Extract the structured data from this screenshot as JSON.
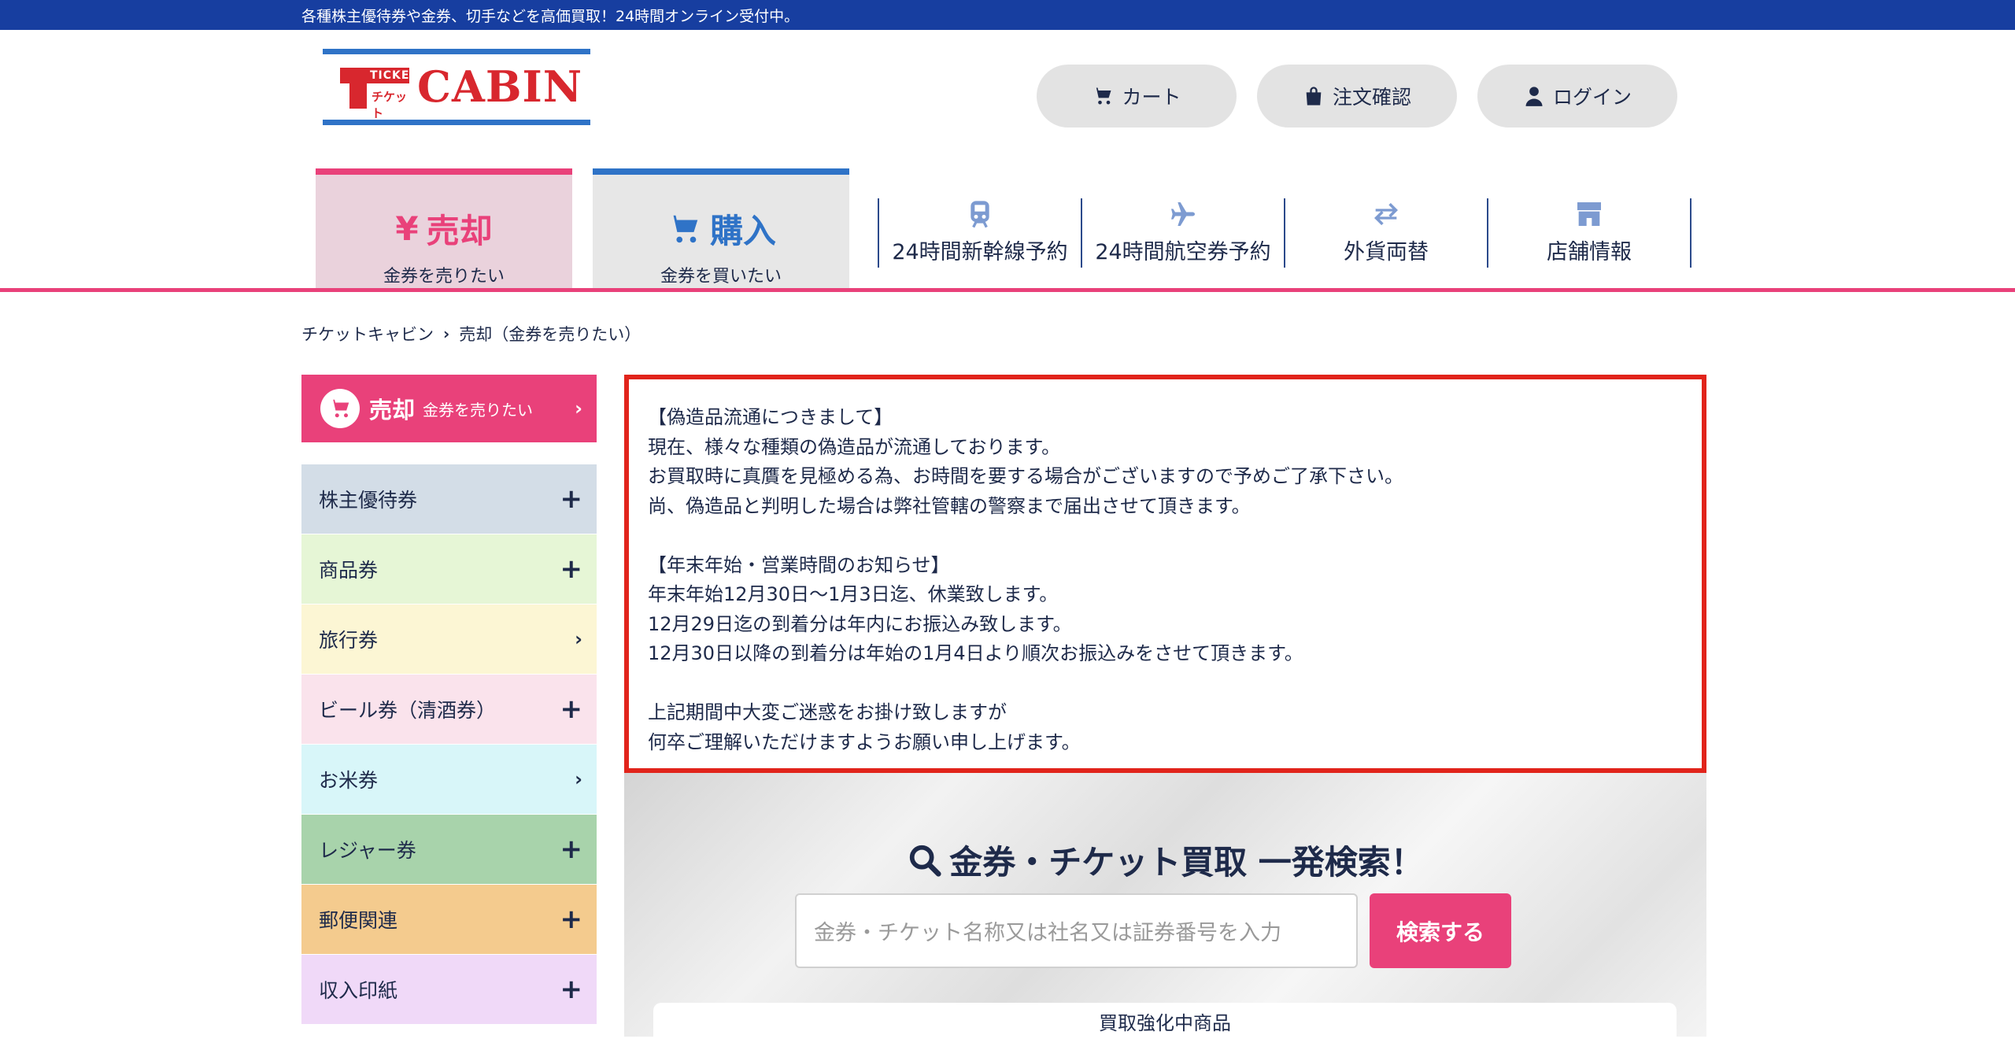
{
  "topbar": {
    "text": "各種株主優待券や金券、切手などを高価買取！24時間オンライン受付中。"
  },
  "logo": {
    "small_top": "TICKET",
    "small_bottom": "チケット",
    "brand": "CABIN"
  },
  "header_buttons": {
    "cart": "カート",
    "order": "注文確認",
    "login": "ログイン"
  },
  "tabs": {
    "sell": {
      "label": "売却",
      "sub": "金券を売りたい",
      "icon": "yen-icon"
    },
    "buy": {
      "label": "購入",
      "sub": "金券を買いたい",
      "icon": "cart-icon"
    }
  },
  "nav": [
    {
      "label": "24時間新幹線予約",
      "icon": "train-icon"
    },
    {
      "label": "24時間航空券予約",
      "icon": "plane-icon"
    },
    {
      "label": "外貨両替",
      "icon": "exchange-icon"
    },
    {
      "label": "店舗情報",
      "icon": "store-icon"
    }
  ],
  "breadcrumb": {
    "home": "チケットキャビン",
    "current": "売却（金券を売りたい）"
  },
  "sidebar": {
    "head_title": "売却",
    "head_sub": "金券を売りたい",
    "items": [
      {
        "label": "株主優待券",
        "mark": "+",
        "color": "#d3dde7"
      },
      {
        "label": "商品券",
        "mark": "+",
        "color": "#e6f6d6"
      },
      {
        "label": "旅行券",
        "mark": "›",
        "color": "#fcf6d4"
      },
      {
        "label": "ビール券（清酒券）",
        "mark": "+",
        "color": "#fae3ec"
      },
      {
        "label": "お米券",
        "mark": "›",
        "color": "#d8f6f9"
      },
      {
        "label": "レジャー券",
        "mark": "+",
        "color": "#a8d3ab"
      },
      {
        "label": "郵便関連",
        "mark": "+",
        "color": "#f4cb8e"
      },
      {
        "label": "収入印紙",
        "mark": "+",
        "color": "#f0d9f8"
      }
    ]
  },
  "notice": {
    "lines": [
      "【偽造品流通につきまして】",
      "現在、様々な種類の偽造品が流通しております。",
      "お買取時に真贋を見極める為、お時間を要する場合がございますので予めご了承下さい。",
      "尚、偽造品と判明した場合は弊社管轄の警察まで届出させて頂きます。",
      "",
      "【年末年始・営業時間のお知らせ】",
      "年末年始12月30日〜1月3日迄、休業致します。",
      "12月29日迄の到着分は年内にお振込み致します。",
      "12月30日以降の到着分は年始の1月4日より順次お振込みをさせて頂きます。",
      "",
      "上記期間中大変ご迷惑をお掛け致しますが",
      "何卒ご理解いただけますようお願い申し上げます。"
    ]
  },
  "search": {
    "title": "金券・チケット買取 一発検索！",
    "placeholder": "金券・チケット名称又は社名又は証券番号を入力",
    "button": "検索する",
    "featured": "買取強化中商品"
  },
  "colors": {
    "brand_pink": "#e9417a",
    "brand_blue": "#173ea0",
    "notice_border": "#e1241b"
  }
}
